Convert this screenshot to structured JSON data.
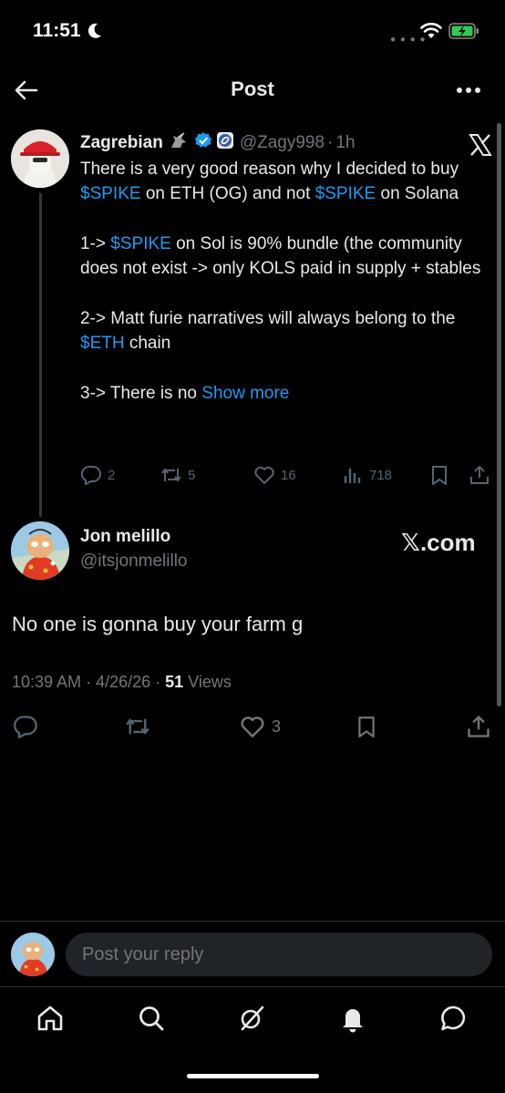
{
  "status_bar": {
    "time": "11:51"
  },
  "header": {
    "title": "Post"
  },
  "parent_post": {
    "name": "Zagrebian",
    "handle": "@Zagy998",
    "sep": "·",
    "time": "1h",
    "p1": {
      "a": "There is a very good reason why I decided to buy ",
      "b": "$SPIKE",
      "c": " on ETH (OG) and not ",
      "d": "$SPIKE",
      "e": " on Solana"
    },
    "p2": {
      "a": "1-> ",
      "b": "$SPIKE",
      "c": " on Sol is 90% bundle (the community does not exist -> only KOLS paid in supply + stables"
    },
    "p3": {
      "a": "2-> Matt furie narratives will always belong to the ",
      "b": "$ETH",
      "c": " chain"
    },
    "p4": {
      "a": "3-> There is no ",
      "b": "Show more"
    },
    "actions": {
      "replies": "2",
      "reposts": "5",
      "likes": "16",
      "views": "718"
    }
  },
  "reply_post": {
    "name": "Jon melillo",
    "handle": "@itsjonmelillo",
    "source": "𝕏.com",
    "text": "No one is gonna buy your farm g",
    "time": "10:39 AM",
    "date": "4/26/26",
    "views_count": "51",
    "views_label": "Views",
    "likes": "3"
  },
  "reply_bar": {
    "placeholder": "Post your reply"
  },
  "colors": {
    "accent": "#1d9bf0",
    "muted": "#71767b",
    "bg": "#000000"
  }
}
